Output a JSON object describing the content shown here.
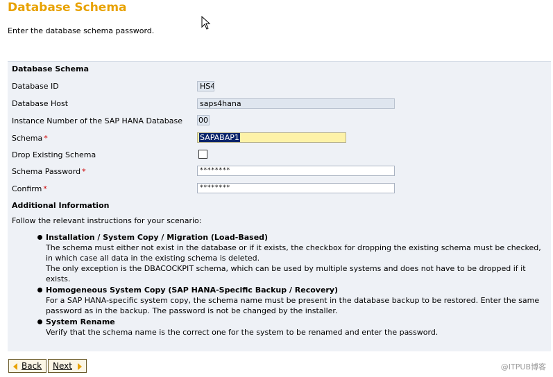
{
  "header": {
    "title": "Database Schema",
    "subtitle": "Enter the database schema password."
  },
  "form": {
    "section_title": "Database Schema",
    "database_id_label": "Database ID",
    "database_id_value": "HS4",
    "database_host_label": "Database Host",
    "database_host_value": "saps4hana",
    "instance_label": "Instance Number of the SAP HANA Database",
    "instance_value": "00",
    "schema_label": "Schema",
    "schema_value": "SAPABAP1",
    "drop_label": "Drop  Existing Schema",
    "drop_checked": false,
    "password_label": "Schema Password",
    "password_value": "********",
    "confirm_label": "Confirm",
    "confirm_value": "********",
    "required_mark": "*"
  },
  "info": {
    "title": "Additional Information",
    "intro": "Follow the relevant instructions for your scenario:",
    "items": [
      {
        "head": "Installation / System Copy / Migration (Load-Based)",
        "body": "The schema must either not exist in the database or if it exists, the checkbox for dropping the existing schema must be checked, in which case all data in the existing schema is deleted.",
        "body2": "The only exception is the DBACOCKPIT schema, which can be used by multiple systems and does not have to be dropped if it exists."
      },
      {
        "head": "Homogeneous System Copy (SAP HANA-Specific Backup / Recovery)",
        "body": "For a SAP HANA-specific system copy, the schema name must be present in the database backup to be restored. Enter the same password as in the backup. The password is not be changed by the installer."
      },
      {
        "head": "System Rename",
        "body": "Verify that the schema name is the correct one for the system to be renamed and enter the password."
      }
    ]
  },
  "buttons": {
    "back": "Back",
    "next": "Next"
  },
  "watermark": "@ITPUB博客",
  "colors": {
    "title": "#e8a200",
    "panel": "#eef1f6",
    "required": "#cc0000",
    "highlight_field": "#fdf2a8"
  }
}
